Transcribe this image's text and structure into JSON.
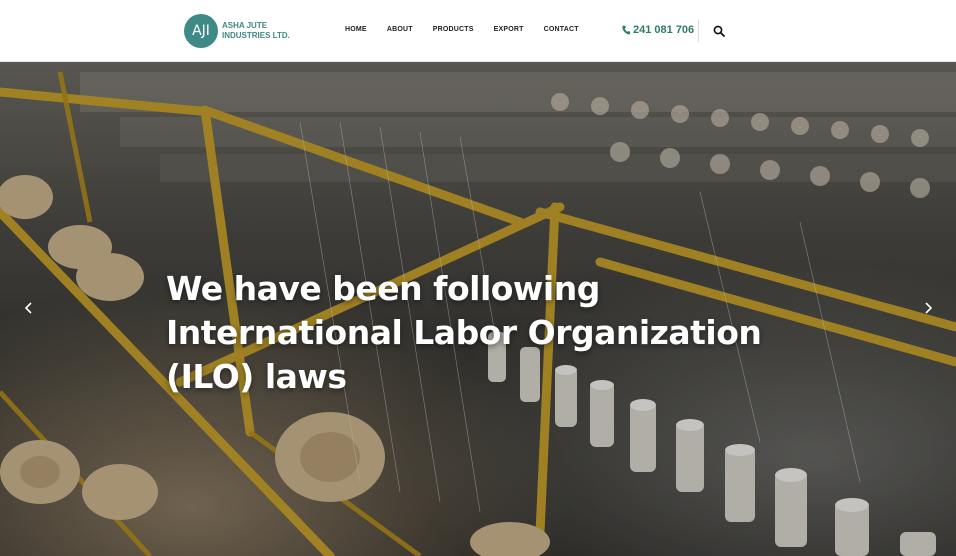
{
  "header": {
    "logo": {
      "mark": "AJI",
      "name_line1": "ASHA JUTE",
      "name_line2": "INDUSTRIES LTD."
    },
    "nav": [
      {
        "label": "HOME"
      },
      {
        "label": "ABOUT"
      },
      {
        "label": "PRODUCTS"
      },
      {
        "label": "EXPORT"
      },
      {
        "label": "CONTACT"
      }
    ],
    "phone": "241 081 706",
    "icons": {
      "phone": "phone-icon",
      "search": "search-icon"
    }
  },
  "hero": {
    "headline": "We have been following International Labor Organization (ILO) laws",
    "prev_icon": "chevron-left-icon",
    "next_icon": "chevron-right-icon"
  },
  "colors": {
    "brand": "#3e8a86",
    "phone": "#2f7d5f",
    "nav_text": "#222222",
    "hero_text": "#ffffff"
  }
}
